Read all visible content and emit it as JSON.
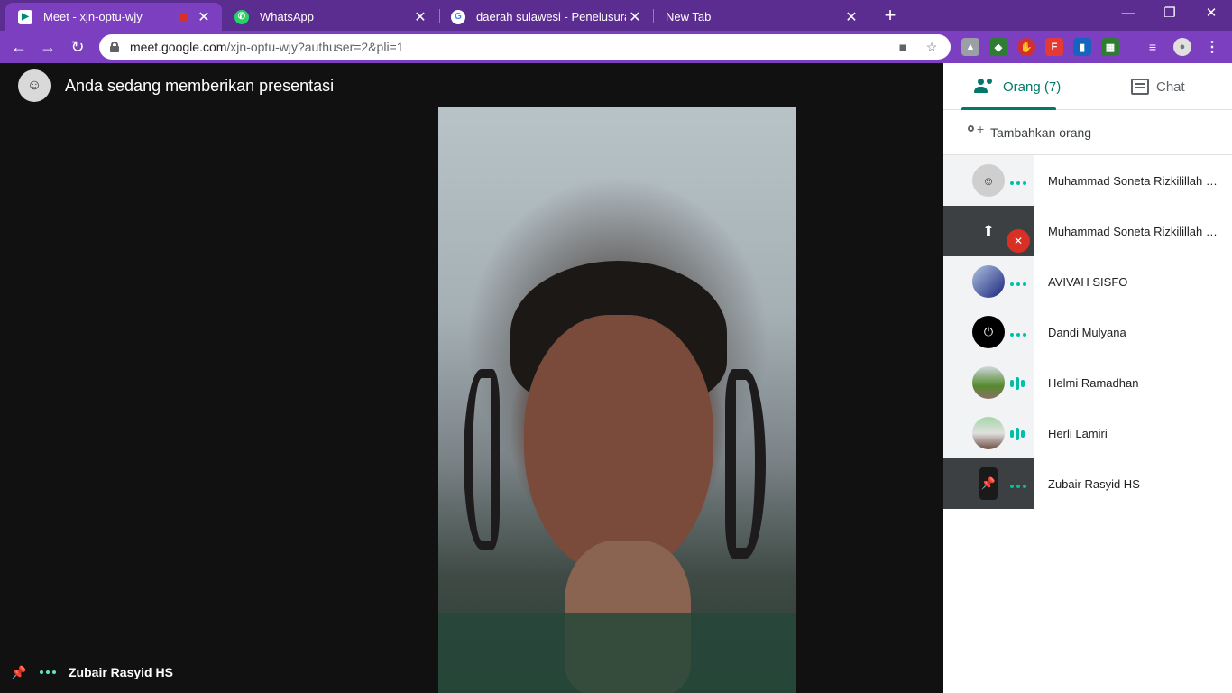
{
  "browser": {
    "tabs": [
      {
        "title": "Meet - xjn-optu-wjy",
        "favicon": "meet-icon",
        "close": "✕"
      },
      {
        "title": "WhatsApp",
        "favicon": "whatsapp-icon",
        "close": "✕"
      },
      {
        "title": "daerah sulawesi - Penelusuran Go",
        "favicon": "google-icon",
        "close": "✕"
      },
      {
        "title": "New Tab",
        "favicon": "",
        "close": "✕"
      }
    ],
    "new_tab": "+",
    "window_controls": {
      "minimize": "—",
      "restore": "❐",
      "close": "✕"
    },
    "nav": {
      "back": "←",
      "forward": "→",
      "reload": "↻"
    },
    "url_host": "meet.google.com",
    "url_path": "/xjn-optu-wjy?authuser=2&pli=1",
    "menu": "⋮"
  },
  "stage": {
    "presenting_title": "Anda sedang memberikan presentasi",
    "pinned_name": "Zubair Rasyid HS"
  },
  "panel": {
    "tab_people": "Orang (7)",
    "tab_chat": "Chat",
    "add_people": "Tambahkan orang",
    "participants": [
      {
        "name": "Muhammad Soneta Rizkilillah (...",
        "status": "idle"
      },
      {
        "name": "Muhammad Soneta Rizkilillah (...",
        "status": "presenting-muted"
      },
      {
        "name": "AVIVAH SISFO",
        "status": "idle"
      },
      {
        "name": "Dandi Mulyana",
        "status": "idle"
      },
      {
        "name": "Helmi Ramadhan",
        "status": "speaking"
      },
      {
        "name": "Herli Lamiri",
        "status": "speaking"
      },
      {
        "name": "Zubair Rasyid HS",
        "status": "idle"
      }
    ]
  },
  "colors": {
    "chrome_frame": "#5b2d91",
    "chrome_toolbar": "#7b3fbf",
    "meet_accent": "#00796b",
    "status_green": "#00bfa5",
    "muted_red": "#d93025"
  }
}
